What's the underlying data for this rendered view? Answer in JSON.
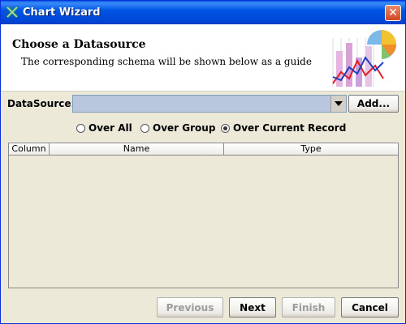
{
  "window": {
    "title": "Chart Wizard",
    "close_symbol": "✕"
  },
  "header": {
    "heading": "Choose a Datasource",
    "subtitle": "The corresponding schema will be shown below as a guide"
  },
  "datasource": {
    "label": "DataSource:",
    "selected": "",
    "add_label": "Add..."
  },
  "radios": [
    {
      "label": "Over All",
      "checked": false
    },
    {
      "label": "Over Group",
      "checked": false
    },
    {
      "label": "Over Current Record",
      "checked": true
    }
  ],
  "table": {
    "columns": [
      "Column",
      "Name",
      "Type"
    ],
    "rows": []
  },
  "buttons": {
    "previous": "Previous",
    "next": "Next",
    "finish": "Finish",
    "cancel": "Cancel"
  }
}
